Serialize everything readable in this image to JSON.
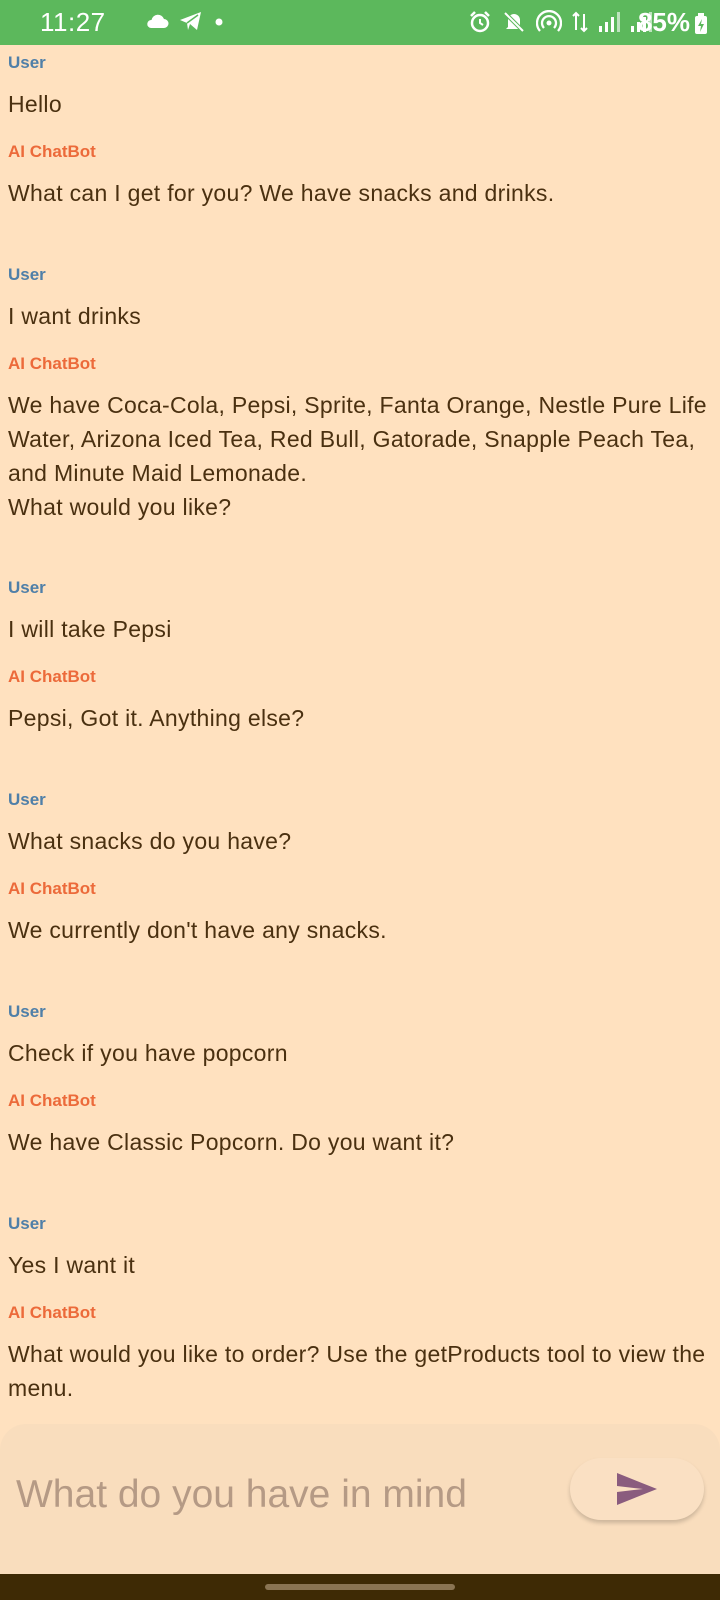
{
  "status_bar": {
    "time": "11:27",
    "battery": "85%",
    "left_icons": [
      "cloud-icon",
      "telegram-icon",
      "dot-icon"
    ],
    "right_icons": [
      "alarm-icon",
      "mute-icon",
      "hotspot-icon",
      "data-arrows-icon",
      "signal-icon",
      "signal-icon"
    ]
  },
  "sender_labels": {
    "user": "User",
    "bot": "AI ChatBot"
  },
  "messages": [
    {
      "role": "user",
      "text": "Hello"
    },
    {
      "role": "bot",
      "text": "What can I get for you? We have snacks and drinks."
    },
    {
      "role": "user",
      "text": "I want drinks"
    },
    {
      "role": "bot",
      "text": "We have Coca-Cola, Pepsi, Sprite, Fanta Orange, Nestle Pure Life Water, Arizona Iced Tea, Red Bull, Gatorade, Snapple Peach Tea, and Minute Maid Lemonade.\nWhat would you like?"
    },
    {
      "role": "user",
      "text": "I will take Pepsi"
    },
    {
      "role": "bot",
      "text": "Pepsi, Got it. Anything else?"
    },
    {
      "role": "user",
      "text": "What snacks do you have?"
    },
    {
      "role": "bot",
      "text": "We currently don't have any snacks."
    },
    {
      "role": "user",
      "text": "Check if you have popcorn"
    },
    {
      "role": "bot",
      "text": "We have Classic Popcorn. Do you want it?"
    },
    {
      "role": "user",
      "text": "Yes I want it"
    },
    {
      "role": "bot",
      "text": "What would you like to order? Use the getProducts tool to view the menu."
    }
  ],
  "composer": {
    "placeholder": "What do you have in mind",
    "value": "",
    "send_icon": "send-icon"
  },
  "colors": {
    "background": "#FFE1BF",
    "status_bar": "#5CB85C",
    "user_label": "#4F7FA8",
    "bot_label": "#EC6A3A",
    "message_text": "#4A3010",
    "send_icon": "#8A5C7E",
    "nav_bar": "#3E2A05"
  }
}
